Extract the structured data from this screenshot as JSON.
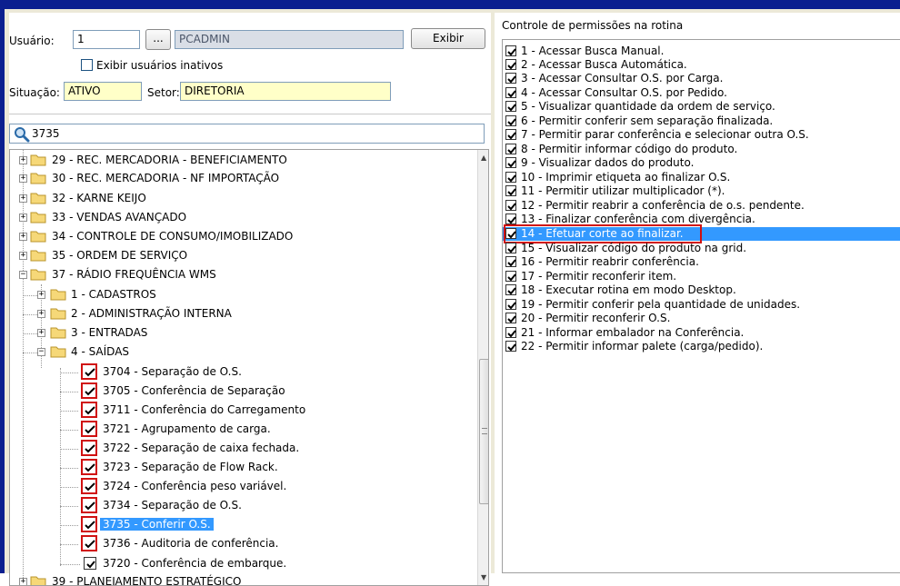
{
  "user": {
    "label": "Usuário:",
    "id_value": "1",
    "lookup_button": "...",
    "name_value": "PCADMIN",
    "exibir_button": "Exibir",
    "inactive_checkbox_label": "Exibir usuários inativos",
    "inactive_checked": false,
    "situacao_label": "Situação:",
    "situacao_value": "ATIVO",
    "setor_label": "Setor:",
    "setor_value": "DIRETORIA"
  },
  "search": {
    "value": "3735"
  },
  "tree": {
    "top_level": [
      {
        "label": "29 - REC. MERCADORIA - BENEFICIAMENTO",
        "expanded": false
      },
      {
        "label": "30 - REC. MERCADORIA - NF IMPORTAÇÃO",
        "expanded": false
      },
      {
        "label": "32 - KARNE KEIJO",
        "expanded": false
      },
      {
        "label": "33 - VENDAS AVANÇADO",
        "expanded": false
      },
      {
        "label": "34 - CONTROLE DE CONSUMO/IMOBILIZADO",
        "expanded": false
      },
      {
        "label": "35 - ORDEM DE SERVIÇO",
        "expanded": false
      },
      {
        "label": "37 - RÁDIO FREQUÊNCIA WMS",
        "expanded": true
      }
    ],
    "sub": [
      {
        "label": "1 - CADASTROS",
        "expanded": false
      },
      {
        "label": "2 - ADMINISTRAÇÃO INTERNA",
        "expanded": false
      },
      {
        "label": "3 - ENTRADAS",
        "expanded": false
      },
      {
        "label": "4 - SAÍDAS",
        "expanded": true
      }
    ],
    "routines": [
      {
        "label": "3704 - Separação de O.S.",
        "checked": true,
        "flagged": true
      },
      {
        "label": "3705 - Conferência de Separação",
        "checked": true,
        "flagged": true
      },
      {
        "label": "3711 - Conferência do Carregamento",
        "checked": true,
        "flagged": true
      },
      {
        "label": "3721 - Agrupamento de carga.",
        "checked": true,
        "flagged": true
      },
      {
        "label": "3722 - Separação de caixa fechada.",
        "checked": true,
        "flagged": true
      },
      {
        "label": "3723 - Separação de Flow Rack.",
        "checked": true,
        "flagged": true
      },
      {
        "label": "3724 - Conferência peso variável.",
        "checked": true,
        "flagged": true
      },
      {
        "label": "3734 - Separação de O.S.",
        "checked": true,
        "flagged": true
      },
      {
        "label": "3735 - Conferir O.S.",
        "checked": true,
        "flagged": true,
        "selected": true
      },
      {
        "label": "3736 - Auditoria de conferência.",
        "checked": true,
        "flagged": true
      },
      {
        "label": "3720 - Conferência de embarque.",
        "checked": true,
        "flagged": false
      }
    ],
    "cut_off": "39 - PLANEJAMENTO ESTRATÉGICO"
  },
  "permissions": {
    "title": "Controle de permissões na rotina",
    "items": [
      {
        "label": "1 - Acessar Busca Manual.",
        "checked": true
      },
      {
        "label": "2 - Acessar Busca Automática.",
        "checked": true
      },
      {
        "label": "3 - Acessar Consultar O.S. por Carga.",
        "checked": true
      },
      {
        "label": "4 - Acessar Consultar O.S. por Pedido.",
        "checked": true
      },
      {
        "label": "5 - Visualizar quantidade da ordem de serviço.",
        "checked": true
      },
      {
        "label": "6 - Permitir conferir sem separação finalizada.",
        "checked": true
      },
      {
        "label": "7 - Permitir parar conferência e selecionar outra O.S.",
        "checked": true
      },
      {
        "label": "8 - Permitir informar código do produto.",
        "checked": true
      },
      {
        "label": "9 - Visualizar dados do produto.",
        "checked": true
      },
      {
        "label": "10 - Imprimir etiqueta ao finalizar O.S.",
        "checked": true
      },
      {
        "label": "11 - Permitir utilizar multiplicador (*).",
        "checked": true
      },
      {
        "label": "12 - Permitir reabrir a conferência de o.s. pendente.",
        "checked": true
      },
      {
        "label": "13 - Finalizar conferência com divergência.",
        "checked": true
      },
      {
        "label": "14 - Efetuar corte ao finalizar.",
        "checked": true,
        "selected": true
      },
      {
        "label": "15 - Visualizar código do produto na grid.",
        "checked": true
      },
      {
        "label": "16 - Permitir reabrir conferência.",
        "checked": true
      },
      {
        "label": "17 - Permitir reconferir item.",
        "checked": true
      },
      {
        "label": "18 - Executar rotina em modo Desktop.",
        "checked": true
      },
      {
        "label": "19 - Permitir conferir pela quantidade de unidades.",
        "checked": true
      },
      {
        "label": "20 - Permitir reconferir O.S.",
        "checked": true
      },
      {
        "label": "21 - Informar embalador na Conferência.",
        "checked": true
      },
      {
        "label": "22 - Permitir informar palete (carga/pedido).",
        "checked": true
      }
    ]
  },
  "colors": {
    "accent_blue": "#0b1f8f",
    "selection": "#3399ff",
    "highlight_red": "#d01010",
    "field_yellow": "#ffffc8"
  }
}
